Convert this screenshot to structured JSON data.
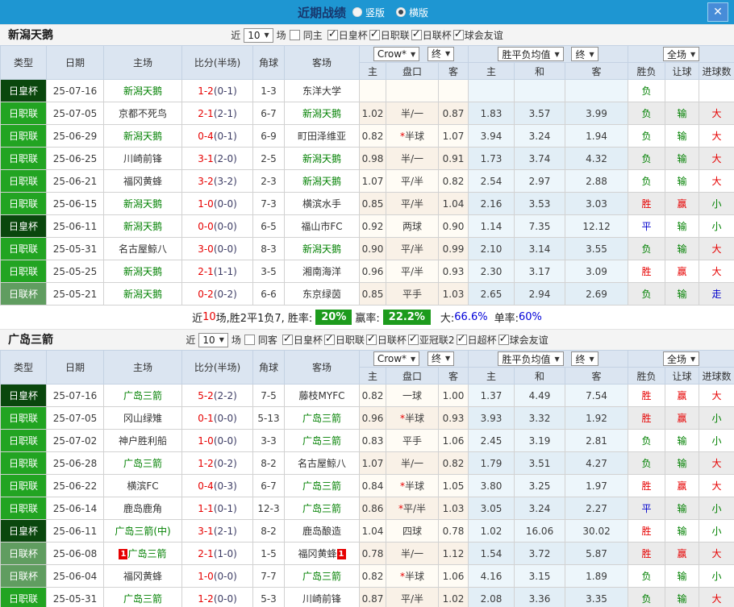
{
  "titlebar": {
    "title": "近期战绩",
    "radio_options": [
      {
        "label": "竖版",
        "selected": false
      },
      {
        "label": "横版",
        "selected": true
      }
    ],
    "close_label": "✕"
  },
  "colors": {
    "titlebar_bg": "#1e96d2",
    "type_emperor_cup": "#0a470d",
    "type_j_league": "#22a422",
    "type_league_cup": "#609d60",
    "self_team_text": "#008000",
    "win_text": "#e60000",
    "lose_text": "#008000",
    "draw_text": "#0000cc",
    "rate_badge_bg": "#1d9b1d"
  },
  "table_header": {
    "type": "类型",
    "date": "日期",
    "home": "主场",
    "score": "比分(半场)",
    "corner": "角球",
    "away": "客场",
    "crow": "Crow*",
    "final1": "终",
    "avg": "胜平负均值",
    "final2": "终",
    "full": "全场",
    "sub_home": "主",
    "sub_handicap": "盘口",
    "sub_away": "客",
    "sub_avg_home": "主",
    "sub_avg_draw": "和",
    "sub_avg_away": "客",
    "sub_wdl": "胜负",
    "sub_let": "让球",
    "sub_goals": "进球数"
  },
  "sections": [
    {
      "team": "新潟天鹅",
      "filter": {
        "near": "近",
        "count": "10",
        "unit": "场",
        "same": "同主",
        "same_checked": false,
        "leagues": [
          "日皇杯",
          "日职联",
          "日联杯",
          "球会友谊"
        ]
      },
      "rows": [
        {
          "t": "日皇杯",
          "tc": "d",
          "d": "25-07-16",
          "h": "新潟天鹅",
          "hs": true,
          "hb": "",
          "s": "1-2",
          "sh": "(0-1)",
          "c": "1-3",
          "a": "东洋大学",
          "as": false,
          "ab": "",
          "o1": "",
          "o2": "",
          "o3": "",
          "v1": "",
          "v2": "",
          "v3": "",
          "r1": "负",
          "r1c": "g",
          "r2": "",
          "r2c": "n",
          "r3": "",
          "r3c": "n"
        },
        {
          "t": "日职联",
          "tc": "b",
          "d": "25-07-05",
          "h": "京都不死鸟",
          "hs": false,
          "hb": "",
          "s": "2-1",
          "sh": "(2-1)",
          "c": "6-7",
          "a": "新潟天鹅",
          "as": true,
          "ab": "",
          "o1": "1.02",
          "o2": "半/一",
          "o3": "0.87",
          "v1": "1.83",
          "v2": "3.57",
          "v3": "3.99",
          "r1": "负",
          "r1c": "g",
          "r2": "输",
          "r2c": "g",
          "r3": "大",
          "r3c": "r"
        },
        {
          "t": "日职联",
          "tc": "b",
          "d": "25-06-29",
          "h": "新潟天鹅",
          "hs": true,
          "hb": "",
          "s": "0-4",
          "sh": "(0-1)",
          "c": "6-9",
          "a": "町田泽维亚",
          "as": false,
          "ab": "",
          "o1": "0.82",
          "o2": "*半球",
          "o3": "1.07",
          "v1": "3.94",
          "v2": "3.24",
          "v3": "1.94",
          "r1": "负",
          "r1c": "g",
          "r2": "输",
          "r2c": "g",
          "r3": "大",
          "r3c": "r"
        },
        {
          "t": "日职联",
          "tc": "b",
          "d": "25-06-25",
          "h": "川崎前锋",
          "hs": false,
          "hb": "",
          "s": "3-1",
          "sh": "(2-0)",
          "c": "2-5",
          "a": "新潟天鹅",
          "as": true,
          "ab": "",
          "o1": "0.98",
          "o2": "半/一",
          "o3": "0.91",
          "v1": "1.73",
          "v2": "3.74",
          "v3": "4.32",
          "r1": "负",
          "r1c": "g",
          "r2": "输",
          "r2c": "g",
          "r3": "大",
          "r3c": "r"
        },
        {
          "t": "日职联",
          "tc": "b",
          "d": "25-06-21",
          "h": "福冈黄蜂",
          "hs": false,
          "hb": "",
          "s": "3-2",
          "sh": "(3-2)",
          "c": "2-3",
          "a": "新潟天鹅",
          "as": true,
          "ab": "",
          "o1": "1.07",
          "o2": "平/半",
          "o3": "0.82",
          "v1": "2.54",
          "v2": "2.97",
          "v3": "2.88",
          "r1": "负",
          "r1c": "g",
          "r2": "输",
          "r2c": "g",
          "r3": "大",
          "r3c": "r"
        },
        {
          "t": "日职联",
          "tc": "b",
          "d": "25-06-15",
          "h": "新潟天鹅",
          "hs": true,
          "hb": "",
          "s": "1-0",
          "sh": "(0-0)",
          "c": "7-3",
          "a": "横滨水手",
          "as": false,
          "ab": "",
          "o1": "0.85",
          "o2": "平/半",
          "o3": "1.04",
          "v1": "2.16",
          "v2": "3.53",
          "v3": "3.03",
          "r1": "胜",
          "r1c": "r",
          "r2": "赢",
          "r2c": "r",
          "r3": "小",
          "r3c": "g"
        },
        {
          "t": "日皇杯",
          "tc": "d",
          "d": "25-06-11",
          "h": "新潟天鹅",
          "hs": true,
          "hb": "",
          "s": "0-0",
          "sh": "(0-0)",
          "c": "6-5",
          "a": "福山市FC",
          "as": false,
          "ab": "",
          "o1": "0.92",
          "o2": "两球",
          "o3": "0.90",
          "v1": "1.14",
          "v2": "7.35",
          "v3": "12.12",
          "r1": "平",
          "r1c": "b",
          "r2": "输",
          "r2c": "g",
          "r3": "小",
          "r3c": "g"
        },
        {
          "t": "日职联",
          "tc": "b",
          "d": "25-05-31",
          "h": "名古屋鲸八",
          "hs": false,
          "hb": "",
          "s": "3-0",
          "sh": "(0-0)",
          "c": "8-3",
          "a": "新潟天鹅",
          "as": true,
          "ab": "",
          "o1": "0.90",
          "o2": "平/半",
          "o3": "0.99",
          "v1": "2.10",
          "v2": "3.14",
          "v3": "3.55",
          "r1": "负",
          "r1c": "g",
          "r2": "输",
          "r2c": "g",
          "r3": "大",
          "r3c": "r"
        },
        {
          "t": "日职联",
          "tc": "b",
          "d": "25-05-25",
          "h": "新潟天鹅",
          "hs": true,
          "hb": "",
          "s": "2-1",
          "sh": "(1-1)",
          "c": "3-5",
          "a": "湘南海洋",
          "as": false,
          "ab": "",
          "o1": "0.96",
          "o2": "平/半",
          "o3": "0.93",
          "v1": "2.30",
          "v2": "3.17",
          "v3": "3.09",
          "r1": "胜",
          "r1c": "r",
          "r2": "赢",
          "r2c": "r",
          "r3": "大",
          "r3c": "r"
        },
        {
          "t": "日联杯",
          "tc": "m",
          "d": "25-05-21",
          "h": "新潟天鹅",
          "hs": true,
          "hb": "",
          "s": "0-2",
          "sh": "(0-2)",
          "c": "6-6",
          "a": "东京绿茵",
          "as": false,
          "ab": "",
          "o1": "0.85",
          "o2": "平手",
          "o3": "1.03",
          "v1": "2.65",
          "v2": "2.94",
          "v3": "2.69",
          "r1": "负",
          "r1c": "g",
          "r2": "输",
          "r2c": "g",
          "r3": "走",
          "r3c": "b"
        }
      ],
      "summary": {
        "pre": "近",
        "num": "10",
        "mid": "场,胜2平1负7, 胜率:",
        "rate": "20%",
        "mid2": "赢率:",
        "rate2": "22.2%",
        "big": "大:",
        "bigv": "66.6%",
        "single": "单率:",
        "singlev": "60%"
      }
    },
    {
      "team": "广岛三箭",
      "filter": {
        "near": "近",
        "count": "10",
        "unit": "场",
        "same": "同客",
        "same_checked": false,
        "leagues": [
          "日皇杯",
          "日职联",
          "日联杯",
          "亚冠联2",
          "日超杯",
          "球会友谊"
        ]
      },
      "rows": [
        {
          "t": "日皇杯",
          "tc": "d",
          "d": "25-07-16",
          "h": "广岛三箭",
          "hs": true,
          "hb": "",
          "s": "5-2",
          "sh": "(2-2)",
          "c": "7-5",
          "a": "藤枝MYFC",
          "as": false,
          "ab": "",
          "o1": "0.82",
          "o2": "一球",
          "o3": "1.00",
          "v1": "1.37",
          "v2": "4.49",
          "v3": "7.54",
          "r1": "胜",
          "r1c": "r",
          "r2": "赢",
          "r2c": "r",
          "r3": "大",
          "r3c": "r"
        },
        {
          "t": "日职联",
          "tc": "b",
          "d": "25-07-05",
          "h": "冈山绿雉",
          "hs": false,
          "hb": "",
          "s": "0-1",
          "sh": "(0-0)",
          "c": "5-13",
          "a": "广岛三箭",
          "as": true,
          "ab": "",
          "o1": "0.96",
          "o2": "*半球",
          "o3": "0.93",
          "v1": "3.93",
          "v2": "3.32",
          "v3": "1.92",
          "r1": "胜",
          "r1c": "r",
          "r2": "赢",
          "r2c": "r",
          "r3": "小",
          "r3c": "g"
        },
        {
          "t": "日职联",
          "tc": "b",
          "d": "25-07-02",
          "h": "神户胜利船",
          "hs": false,
          "hb": "",
          "s": "1-0",
          "sh": "(0-0)",
          "c": "3-3",
          "a": "广岛三箭",
          "as": true,
          "ab": "",
          "o1": "0.83",
          "o2": "平手",
          "o3": "1.06",
          "v1": "2.45",
          "v2": "3.19",
          "v3": "2.81",
          "r1": "负",
          "r1c": "g",
          "r2": "输",
          "r2c": "g",
          "r3": "小",
          "r3c": "g"
        },
        {
          "t": "日职联",
          "tc": "b",
          "d": "25-06-28",
          "h": "广岛三箭",
          "hs": true,
          "hb": "",
          "s": "1-2",
          "sh": "(0-2)",
          "c": "8-2",
          "a": "名古屋鲸八",
          "as": false,
          "ab": "",
          "o1": "1.07",
          "o2": "半/一",
          "o3": "0.82",
          "v1": "1.79",
          "v2": "3.51",
          "v3": "4.27",
          "r1": "负",
          "r1c": "g",
          "r2": "输",
          "r2c": "g",
          "r3": "大",
          "r3c": "r"
        },
        {
          "t": "日职联",
          "tc": "b",
          "d": "25-06-22",
          "h": "横滨FC",
          "hs": false,
          "hb": "",
          "s": "0-4",
          "sh": "(0-3)",
          "c": "6-7",
          "a": "广岛三箭",
          "as": true,
          "ab": "",
          "o1": "0.84",
          "o2": "*半球",
          "o3": "1.05",
          "v1": "3.80",
          "v2": "3.25",
          "v3": "1.97",
          "r1": "胜",
          "r1c": "r",
          "r2": "赢",
          "r2c": "r",
          "r3": "大",
          "r3c": "r"
        },
        {
          "t": "日职联",
          "tc": "b",
          "d": "25-06-14",
          "h": "鹿岛鹿角",
          "hs": false,
          "hb": "",
          "s": "1-1",
          "sh": "(0-1)",
          "c": "12-3",
          "a": "广岛三箭",
          "as": true,
          "ab": "",
          "o1": "0.86",
          "o2": "*平/半",
          "o3": "1.03",
          "v1": "3.05",
          "v2": "3.24",
          "v3": "2.27",
          "r1": "平",
          "r1c": "b",
          "r2": "输",
          "r2c": "g",
          "r3": "小",
          "r3c": "g"
        },
        {
          "t": "日皇杯",
          "tc": "d",
          "d": "25-06-11",
          "h": "广岛三箭(中)",
          "hs": true,
          "hb": "",
          "s": "3-1",
          "sh": "(2-1)",
          "c": "8-2",
          "a": "鹿岛酿造",
          "as": false,
          "ab": "",
          "o1": "1.04",
          "o2": "四球",
          "o3": "0.78",
          "v1": "1.02",
          "v2": "16.06",
          "v3": "30.02",
          "r1": "胜",
          "r1c": "r",
          "r2": "输",
          "r2c": "g",
          "r3": "小",
          "r3c": "g"
        },
        {
          "t": "日联杯",
          "tc": "m",
          "d": "25-06-08",
          "h": "广岛三箭",
          "hs": true,
          "hb": "1",
          "s": "2-1",
          "sh": "(1-0)",
          "c": "1-5",
          "a": "福冈黄蜂",
          "as": false,
          "ab": "1",
          "o1": "0.78",
          "o2": "半/一",
          "o3": "1.12",
          "v1": "1.54",
          "v2": "3.72",
          "v3": "5.87",
          "r1": "胜",
          "r1c": "r",
          "r2": "赢",
          "r2c": "r",
          "r3": "大",
          "r3c": "r"
        },
        {
          "t": "日联杯",
          "tc": "m",
          "d": "25-06-04",
          "h": "福冈黄蜂",
          "hs": false,
          "hb": "",
          "s": "1-0",
          "sh": "(0-0)",
          "c": "7-7",
          "a": "广岛三箭",
          "as": true,
          "ab": "",
          "o1": "0.82",
          "o2": "*半球",
          "o3": "1.06",
          "v1": "4.16",
          "v2": "3.15",
          "v3": "1.89",
          "r1": "负",
          "r1c": "g",
          "r2": "输",
          "r2c": "g",
          "r3": "小",
          "r3c": "g"
        },
        {
          "t": "日职联",
          "tc": "b",
          "d": "25-05-31",
          "h": "广岛三箭",
          "hs": true,
          "hb": "",
          "s": "1-2",
          "sh": "(0-0)",
          "c": "5-3",
          "a": "川崎前锋",
          "as": false,
          "ab": "",
          "o1": "0.87",
          "o2": "平/半",
          "o3": "1.02",
          "v1": "2.08",
          "v2": "3.36",
          "v3": "3.35",
          "r1": "负",
          "r1c": "g",
          "r2": "输",
          "r2c": "g",
          "r3": "大",
          "r3c": "r"
        }
      ]
    }
  ]
}
